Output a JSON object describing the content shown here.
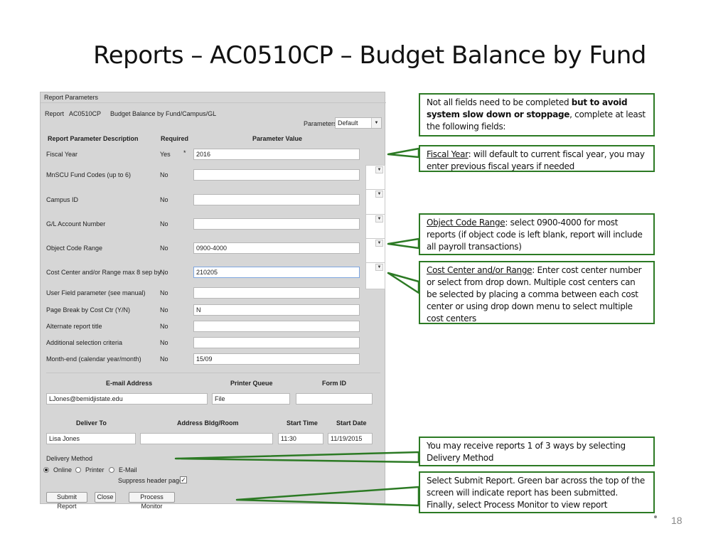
{
  "title": "Reports – AC0510CP – Budget Balance by Fund",
  "panel": {
    "header": "Report Parameters",
    "report_label": "Report",
    "report_id": "AC0510CP",
    "report_name": "Budget Balance by Fund/Campus/GL",
    "parameters_label": "Parameters",
    "parameters_value": "Default",
    "col_description": "Report Parameter Description",
    "col_required": "Required",
    "col_value": "Parameter Value",
    "rows": [
      {
        "label": "Fiscal Year",
        "required": "Yes",
        "mark": "*",
        "value": "2016"
      },
      {
        "label": "MnSCU Fund Codes (up to 6)",
        "required": "No",
        "value": ""
      },
      {
        "label": "Campus ID",
        "required": "No",
        "value": ""
      },
      {
        "label": "G/L Account Number",
        "required": "No",
        "value": ""
      },
      {
        "label": "Object Code Range",
        "required": "No",
        "value": "0900-4000"
      },
      {
        "label": "Cost Center and/or Range max 8 sep by ,",
        "required": "No",
        "value": "210205"
      },
      {
        "label": "User Field parameter (see manual)",
        "required": "No",
        "value": ""
      },
      {
        "label": "Page Break by Cost Ctr (Y/N)",
        "required": "No",
        "value": "N"
      },
      {
        "label": "Alternate report title",
        "required": "No",
        "value": ""
      },
      {
        "label": "Additional selection criteria",
        "required": "No",
        "value": ""
      },
      {
        "label": "Month-end (calendar year/month)",
        "required": "No",
        "value": "15/09"
      }
    ],
    "email_header": "E-mail Address",
    "printer_header": "Printer Queue",
    "formid_header": "Form ID",
    "email_value": "LJones@bemidjistate.edu",
    "printer_value": "File",
    "formid_value": "",
    "deliver_header": "Deliver To",
    "address_header": "Address Bldg/Room",
    "start_time_header": "Start Time",
    "start_date_header": "Start Date",
    "deliver_value": "Lisa Jones",
    "address_value": "",
    "start_time_value": "11:30",
    "start_date_value": "11/19/2015",
    "delivery_method_label": "Delivery Method",
    "delivery_options": [
      "Online",
      "Printer",
      "E-Mail"
    ],
    "suppress_label": "Suppress header page",
    "suppress_check": "✓",
    "submit_label": "Submit Report",
    "close_label": "Close",
    "process_monitor_label": "Process Monitor"
  },
  "callouts": {
    "c1_normal": "Not all fields need to be completed ",
    "c1_bold": "but to avoid system slow down or stoppage",
    "c1_tail": ", complete at least the following fields:",
    "c2_term": "Fiscal Year",
    "c2_rest": ": will default to current fiscal year, you may enter previous fiscal years if needed",
    "c3_term": "Object Code Range",
    "c3_rest": ": select 0900-4000 for most reports (if object code is left blank, report will include all payroll transactions)",
    "c4_term": "Cost Center and/or Range",
    "c4_rest": ": Enter cost center number or select from drop down.  Multiple cost centers can be selected by placing a comma between each cost center or using drop down menu to select multiple cost centers",
    "c5": "You may receive reports  1 of 3 ways by selecting Delivery Method",
    "c6": "Select Submit Report.  Green bar across the top of the screen will indicate report has been submitted. Finally, select Process Monitor to view report"
  },
  "page_number": "18",
  "colors": {
    "callout_border": "#2c7a24",
    "panel_bg": "#d6d6d6"
  }
}
